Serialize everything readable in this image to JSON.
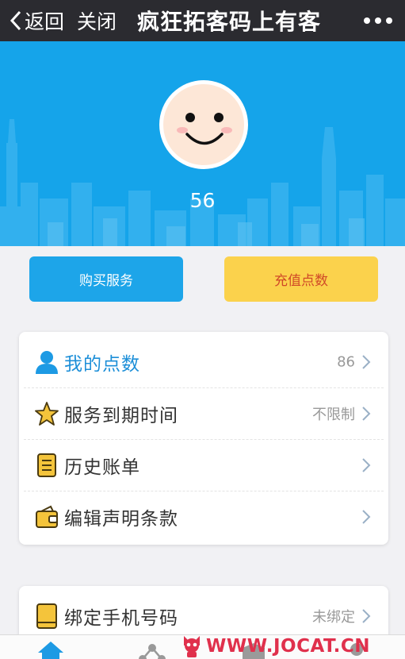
{
  "header": {
    "back_label": "返回",
    "close_label": "关闭",
    "title": "疯狂拓客码上有客"
  },
  "profile": {
    "user_number": "56"
  },
  "actions": {
    "buy_label": "购买服务",
    "recharge_label": "充值点数"
  },
  "menu": {
    "items": [
      {
        "label": "我的点数",
        "value": "86",
        "icon": "user-icon"
      },
      {
        "label": "服务到期时间",
        "value": "不限制",
        "icon": "star-icon"
      },
      {
        "label": "历史账单",
        "value": "",
        "icon": "ledger-icon"
      },
      {
        "label": "编辑声明条款",
        "value": "",
        "icon": "wallet-icon"
      }
    ]
  },
  "account": {
    "bind_phone_label": "绑定手机号码",
    "bind_phone_value": "未绑定"
  },
  "watermark": {
    "text": "WWW.JOCAT.CN"
  },
  "colors": {
    "hero_blue": "#15a4ea",
    "buy_button": "#1da5e9",
    "recharge_button": "#fbd24c",
    "recharge_text": "#d04a28",
    "header_bg": "#2b2b30"
  }
}
